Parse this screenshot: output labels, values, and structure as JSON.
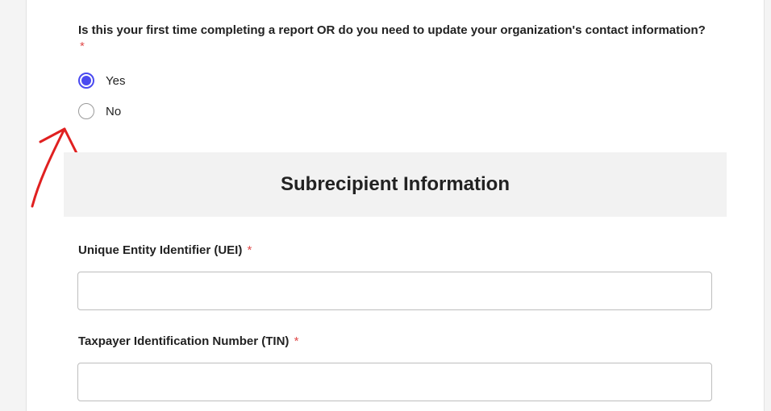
{
  "question": {
    "label": "Is this your first time completing a report OR do you need to update your organization's contact information?",
    "required_mark": "*",
    "options": [
      {
        "label": "Yes",
        "selected": true
      },
      {
        "label": "No",
        "selected": false
      }
    ]
  },
  "section": {
    "title": "Subrecipient Information"
  },
  "fields": [
    {
      "label": "Unique Entity Identifier (UEI)",
      "required_mark": "*",
      "value": ""
    },
    {
      "label": "Taxpayer Identification Number (TIN)",
      "required_mark": "*",
      "value": ""
    }
  ],
  "colors": {
    "accent": "#4a4af0",
    "required": "#e04b4b",
    "annotation_arrow": "#e02020"
  }
}
